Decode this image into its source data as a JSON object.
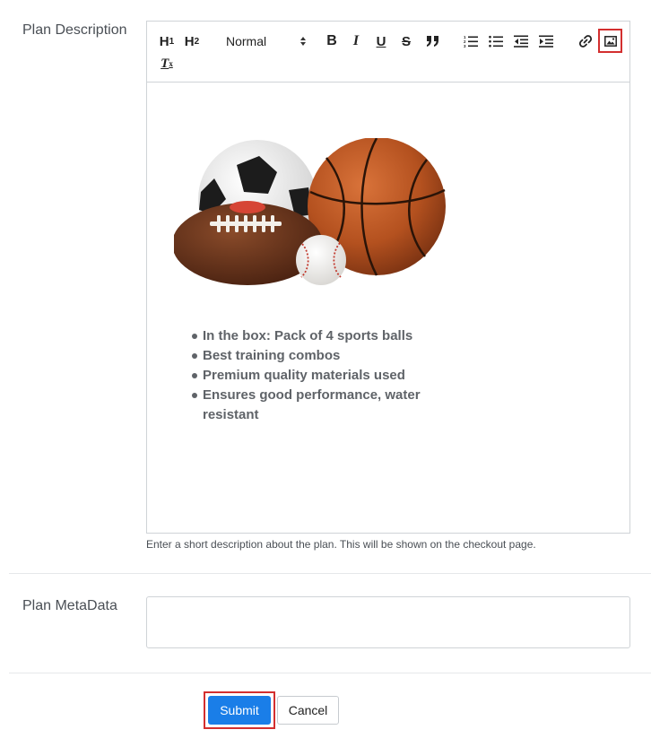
{
  "plan_description": {
    "label": "Plan Description",
    "toolbar": {
      "h1": "H",
      "h1_sub": "1",
      "h2": "H",
      "h2_sub": "2",
      "header_select_value": "Normal",
      "bold": "B",
      "italic": "I",
      "underline": "U",
      "strike": "S",
      "clear_format": "T",
      "highlighted_tool": "image"
    },
    "content": {
      "image": "sports-balls-image",
      "bullets": [
        "In the box: Pack of 4 sports balls",
        "Best training combos",
        "Premium quality materials used",
        "Ensures good performance, water resistant"
      ]
    },
    "help_text": "Enter a short description about the plan. This will be shown on the checkout page."
  },
  "plan_metadata": {
    "label": "Plan MetaData",
    "value": ""
  },
  "actions": {
    "submit_label": "Submit",
    "cancel_label": "Cancel"
  },
  "colors": {
    "accent": "#1a7ee8",
    "highlight_box": "#d32f2f",
    "border": "#cfd3d7"
  }
}
